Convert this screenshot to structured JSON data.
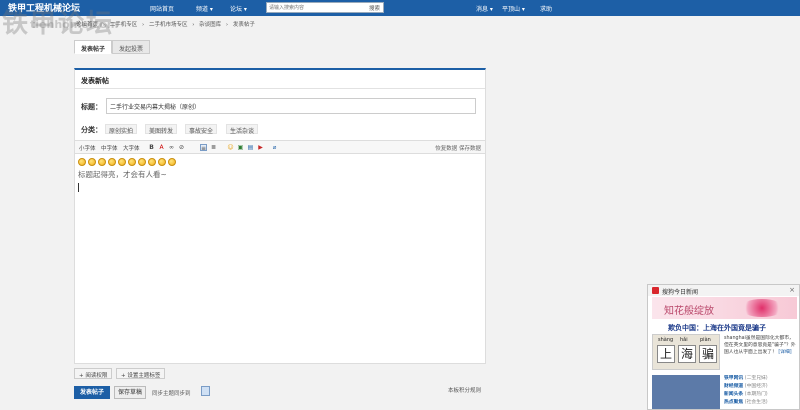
{
  "header": {
    "site_title": "铁甲工程机械论坛",
    "site_sub": "tiehhome.com",
    "watermark": "铁甲论坛",
    "watermark_url": "tiehhome.com",
    "nav": [
      "网站首页",
      "频道 ▾",
      "论坛 ▾"
    ],
    "search_placeholder": "请输入搜索内容",
    "search_button": "搜索",
    "right_links": [
      "消息 ▾",
      "平顶山 ▾",
      "求助"
    ]
  },
  "breadcrumb": [
    "论坛首页",
    "›",
    "二手机专区",
    "›",
    "二手机市场专区",
    "›",
    "杂谈图库",
    "›",
    "发表帖子"
  ],
  "tabs": [
    {
      "label": "发表帖子",
      "active": true
    },
    {
      "label": "发起投票",
      "active": false
    }
  ],
  "form": {
    "heading": "发表新帖",
    "title_label": "标题：",
    "title_value": "二手行业交易内幕大揭秘（原创）",
    "category_label": "分类：",
    "categories": [
      "原创实拍",
      "美图转发",
      "事故安全",
      "生活杂谈"
    ]
  },
  "editor": {
    "font_sizes": [
      "小字体",
      "中字体",
      "大字体"
    ],
    "tools_right": "恢复数据 保存数据",
    "emoji_count": 10,
    "body_text": "标题起得亮，才会有人看~"
  },
  "below": {
    "read_permission": "+ 阅读权限",
    "set_tags": "+ 设置主题标签",
    "submit": "发表帖子",
    "save_draft": "保存草稿",
    "sync_label": "同步主题同步到",
    "rules": "本板积分规则"
  },
  "popup": {
    "title": "搜狗今日新闻",
    "close": "×",
    "banner": "知花般绽放",
    "headline": "欺负中国：上海在外国竟是骗子",
    "pinyin": [
      "shàng",
      "hǎi",
      "piàn"
    ],
    "hanzi": [
      "上",
      "海",
      "骗"
    ],
    "paragraph": "shanghai虽然是国际化大都市，但在英文里的意思竟是\"骗子\"？外国人也从字面上出发了！",
    "more": "[详细]",
    "list": [
      {
        "title": "铁甲网讯",
        "note": "(二宝兄妹)"
      },
      {
        "title": "财经频道",
        "note": "(中国经济)"
      },
      {
        "title": "新闻头条",
        "note": "(本期热门)"
      },
      {
        "title": "热点聚焦",
        "note": "(社会生活)"
      }
    ]
  },
  "colors": {
    "brand": "#1d5fa6",
    "panel_bg": "#ffffff",
    "page_bg": "#f2f2f2"
  }
}
